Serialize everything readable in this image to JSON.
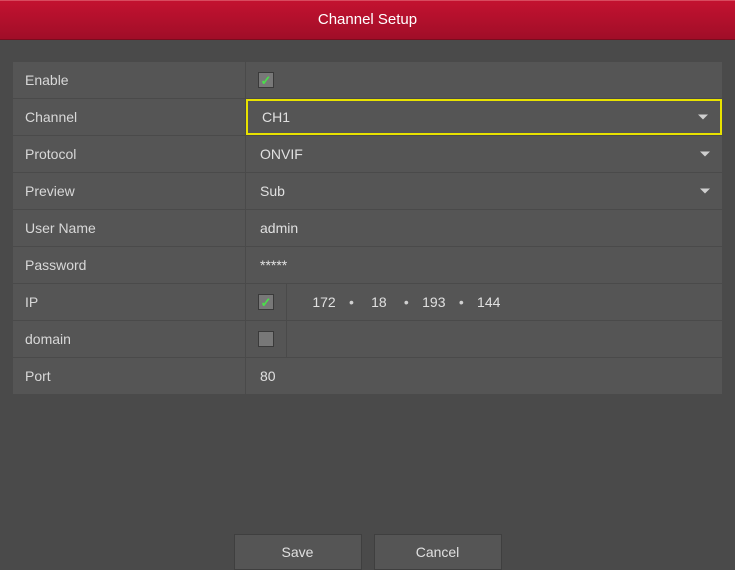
{
  "title": "Channel Setup",
  "labels": {
    "enable": "Enable",
    "channel": "Channel",
    "protocol": "Protocol",
    "preview": "Preview",
    "username": "User Name",
    "password": "Password",
    "ip": "IP",
    "domain": "domain",
    "port": "Port"
  },
  "values": {
    "enable_checked": true,
    "channel": "CH1",
    "protocol": "ONVIF",
    "preview": "Sub",
    "username": "admin",
    "password": "*****",
    "ip_checked": true,
    "ip": {
      "o1": "172",
      "o2": "18",
      "o3": "193",
      "o4": "144"
    },
    "domain_checked": false,
    "domain": "",
    "port": "80"
  },
  "buttons": {
    "save": "Save",
    "cancel": "Cancel"
  },
  "ip_sep": "•"
}
